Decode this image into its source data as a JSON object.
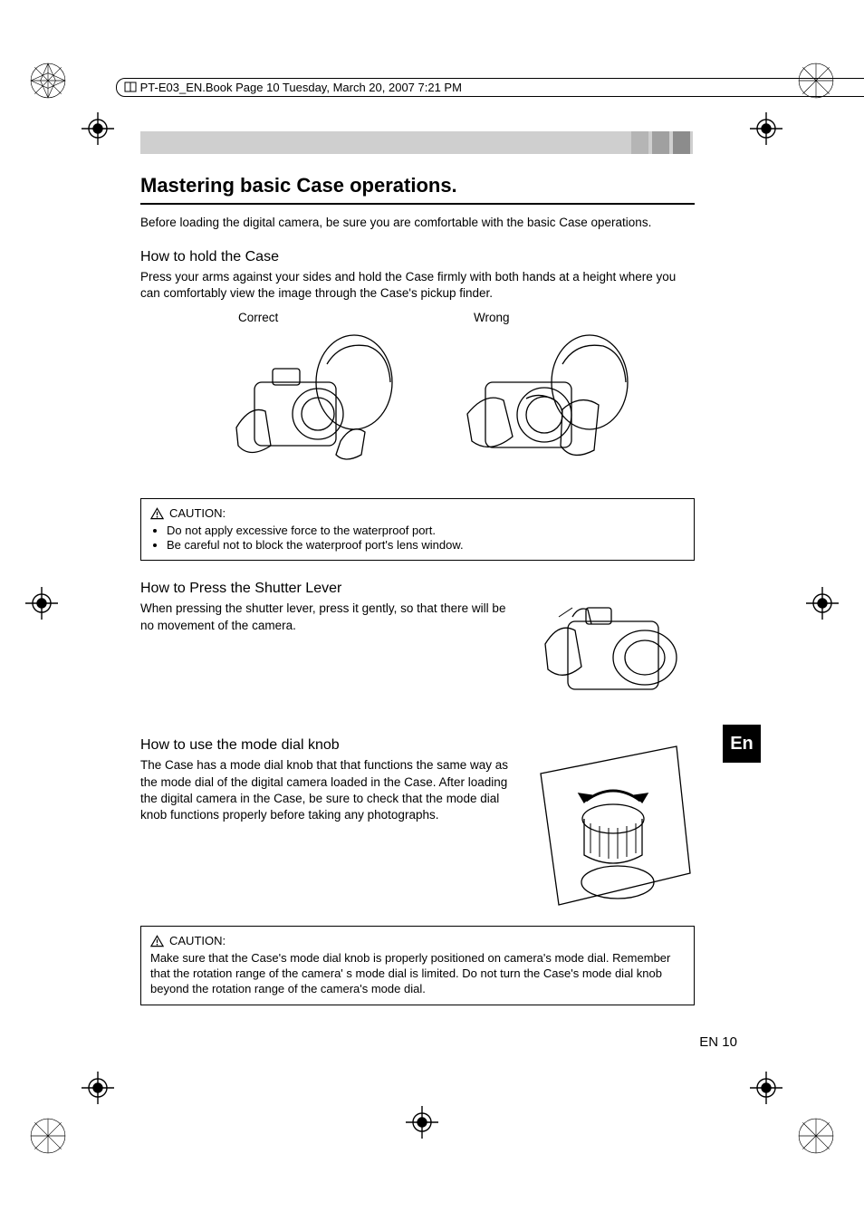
{
  "header": {
    "running_head": "PT-E03_EN.Book  Page 10  Tuesday, March 20, 2007  7:21 PM"
  },
  "page": {
    "title": "Mastering basic Case operations.",
    "intro": "Before loading the digital camera, be sure you are comfortable with the basic Case operations.",
    "page_label": "EN 10",
    "lang_tab": "En"
  },
  "section_hold": {
    "heading": "How to hold the Case",
    "body": "Press your arms against your sides and hold the Case firmly with both hands at a height where you can comfortably view the image through the Case's pickup finder.",
    "label_correct": "Correct",
    "label_wrong": "Wrong"
  },
  "caution1": {
    "label": "CAUTION:",
    "items": [
      "Do not apply excessive force to the waterproof port.",
      "Be careful not to block the waterproof port's lens window."
    ]
  },
  "section_shutter": {
    "heading": "How to Press the Shutter Lever",
    "body": "When pressing the shutter lever, press it gently, so that there will be no movement of the camera."
  },
  "section_modedial": {
    "heading": "How to use the mode dial knob",
    "body": "The Case has a mode dial knob that that functions the same way as the mode dial of the digital camera loaded in the Case. After loading the digital camera in the Case, be sure to check that the mode dial knob functions properly before taking any photographs."
  },
  "caution2": {
    "label": "CAUTION:",
    "body": "Make sure that the Case's mode dial knob is properly positioned on camera's mode dial. Remember that the rotation range of the camera' s mode dial is limited. Do not turn the Case's mode dial knob beyond the rotation range of the camera's mode dial."
  }
}
